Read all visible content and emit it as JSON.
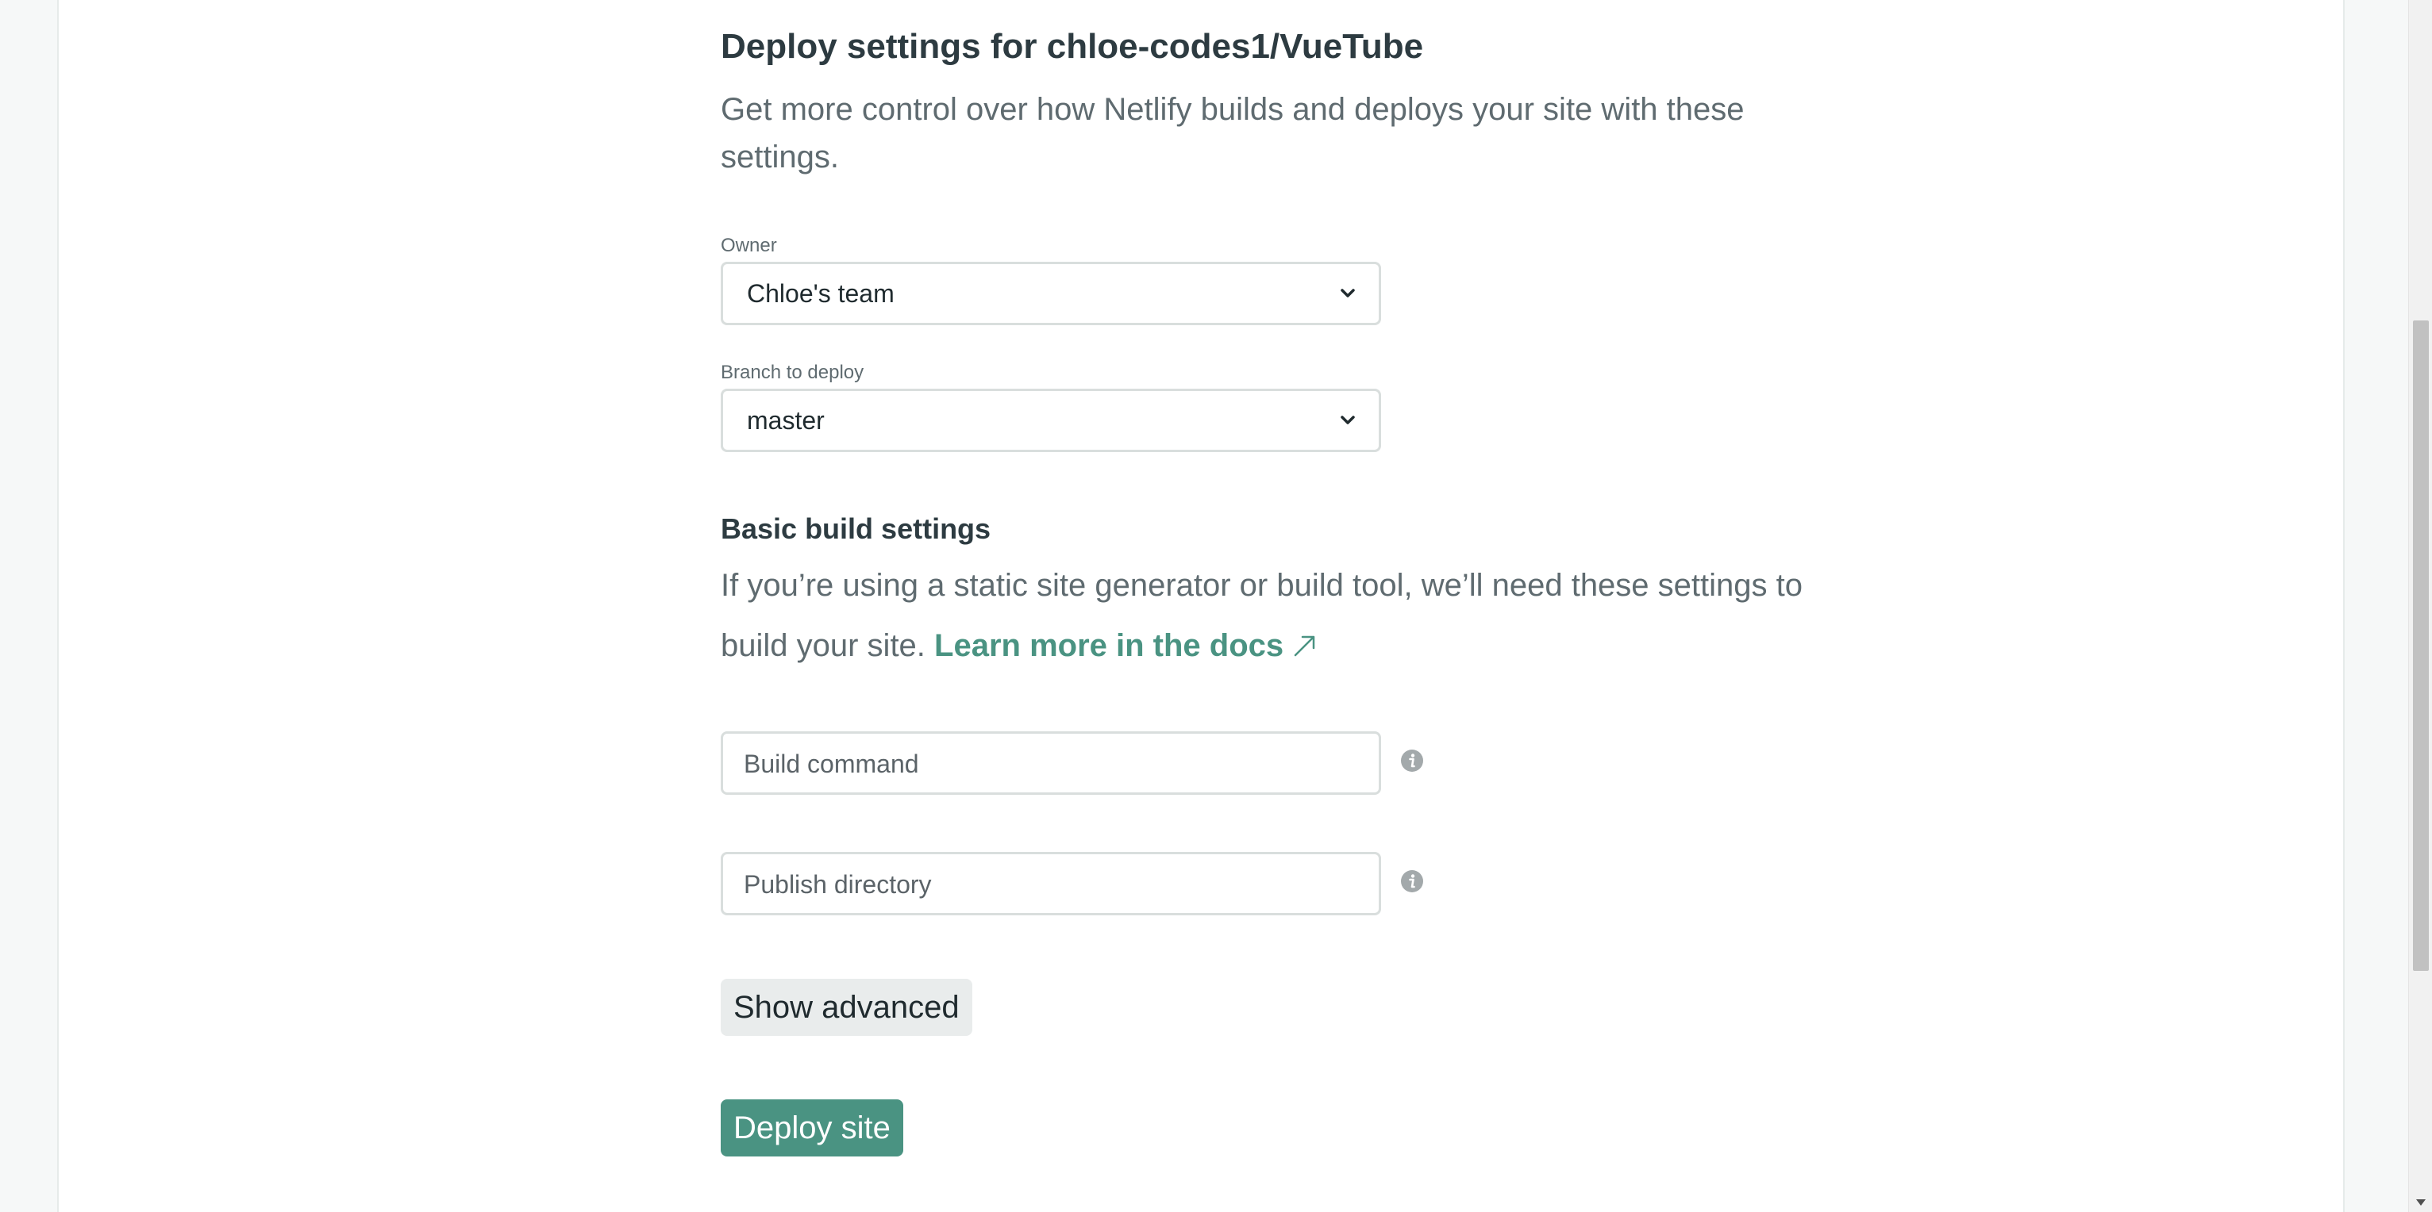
{
  "deploy": {
    "heading": "Deploy settings for chloe-codes1/VueTube",
    "intro": "Get more control over how Netlify builds and deploys your site with these settings."
  },
  "owner": {
    "label": "Owner",
    "selected": "Chloe's team"
  },
  "branch": {
    "label": "Branch to deploy",
    "selected": "master"
  },
  "build_settings": {
    "title": "Basic build settings",
    "description": "If you’re using a static site generator or build tool, we’ll need these settings to build your site.",
    "docs_link": "Learn more in the docs"
  },
  "build_command": {
    "placeholder": "Build command"
  },
  "publish_directory": {
    "placeholder": "Publish directory"
  },
  "buttons": {
    "show_advanced": "Show advanced",
    "deploy_site": "Deploy site"
  },
  "icons": {
    "select_chevron": "chevron-down-icon",
    "external_link": "external-link-arrow-icon",
    "info": "info-icon",
    "scroll_down": "scroll-down-arrow-icon"
  },
  "colors": {
    "accent": "#4a9382",
    "heading": "#2d3b41",
    "body_text": "#5f6b70",
    "secondary_button_bg": "#e9ecec",
    "input_border": "#d9dedd"
  }
}
